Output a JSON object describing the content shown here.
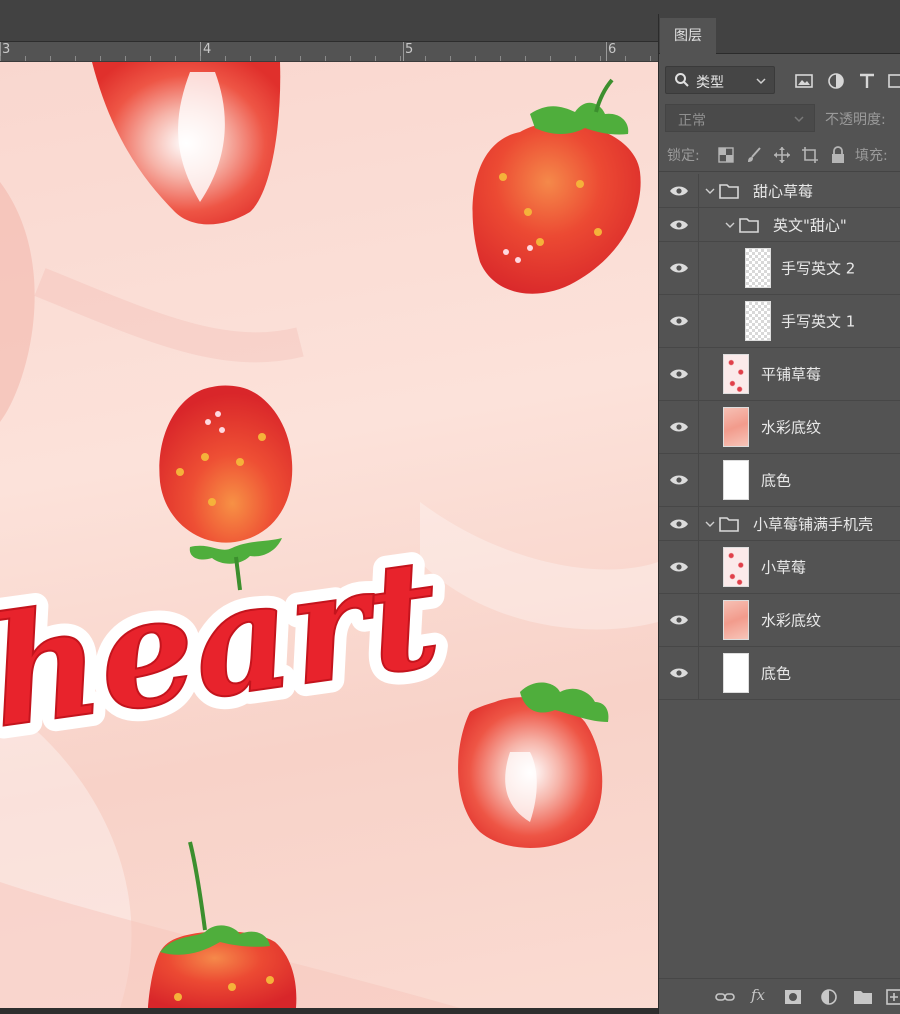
{
  "ruler": {
    "labels": [
      "3",
      "4",
      "5",
      "6"
    ]
  },
  "canvas": {
    "artwork_text": "heart",
    "colors": {
      "background": "#fadbd2",
      "text_red": "#e8232c",
      "strawberry_red": "#e8352c",
      "leaf_green": "#4fae3c"
    }
  },
  "panel": {
    "tab_label": "图层",
    "filter": {
      "selected": "类型",
      "search_icon": "search-icon"
    },
    "filter_icons": [
      "image-filter-icon",
      "adjustment-filter-icon",
      "type-filter-icon",
      "shape-filter-icon"
    ],
    "blend_mode": "正常",
    "opacity_label": "不透明度:",
    "lock_label": "锁定:",
    "lock_icons": [
      "lock-pixels-icon",
      "lock-paint-icon",
      "lock-move-icon",
      "lock-artboard-icon"
    ],
    "fill_label": "填充:",
    "layers": [
      {
        "name": "甜心草莓",
        "kind": "group",
        "visible": true
      },
      {
        "name": "英文\"甜心\"",
        "kind": "group",
        "visible": true
      },
      {
        "name": "手写英文 2",
        "kind": "layer",
        "thumb": "transparent",
        "visible": true
      },
      {
        "name": "手写英文 1",
        "kind": "layer",
        "thumb": "transparent",
        "visible": true
      },
      {
        "name": "平铺草莓",
        "kind": "layer",
        "thumb": "strawberry",
        "visible": true
      },
      {
        "name": "水彩底纹",
        "kind": "layer",
        "thumb": "watercolor",
        "visible": true
      },
      {
        "name": "底色",
        "kind": "layer",
        "thumb": "white",
        "visible": true
      },
      {
        "name": "小草莓铺满手机壳",
        "kind": "group",
        "visible": true
      },
      {
        "name": "小草莓",
        "kind": "layer",
        "thumb": "strawberry",
        "visible": true
      },
      {
        "name": "水彩底纹",
        "kind": "layer",
        "thumb": "watercolor",
        "visible": true
      },
      {
        "name": "底色",
        "kind": "layer",
        "thumb": "white",
        "visible": true
      }
    ],
    "footer_icons": [
      "link-icon",
      "fx-icon",
      "mask-icon",
      "adjustment-icon",
      "folder-icon",
      "new-layer-icon"
    ],
    "footer_fx": "fx"
  }
}
